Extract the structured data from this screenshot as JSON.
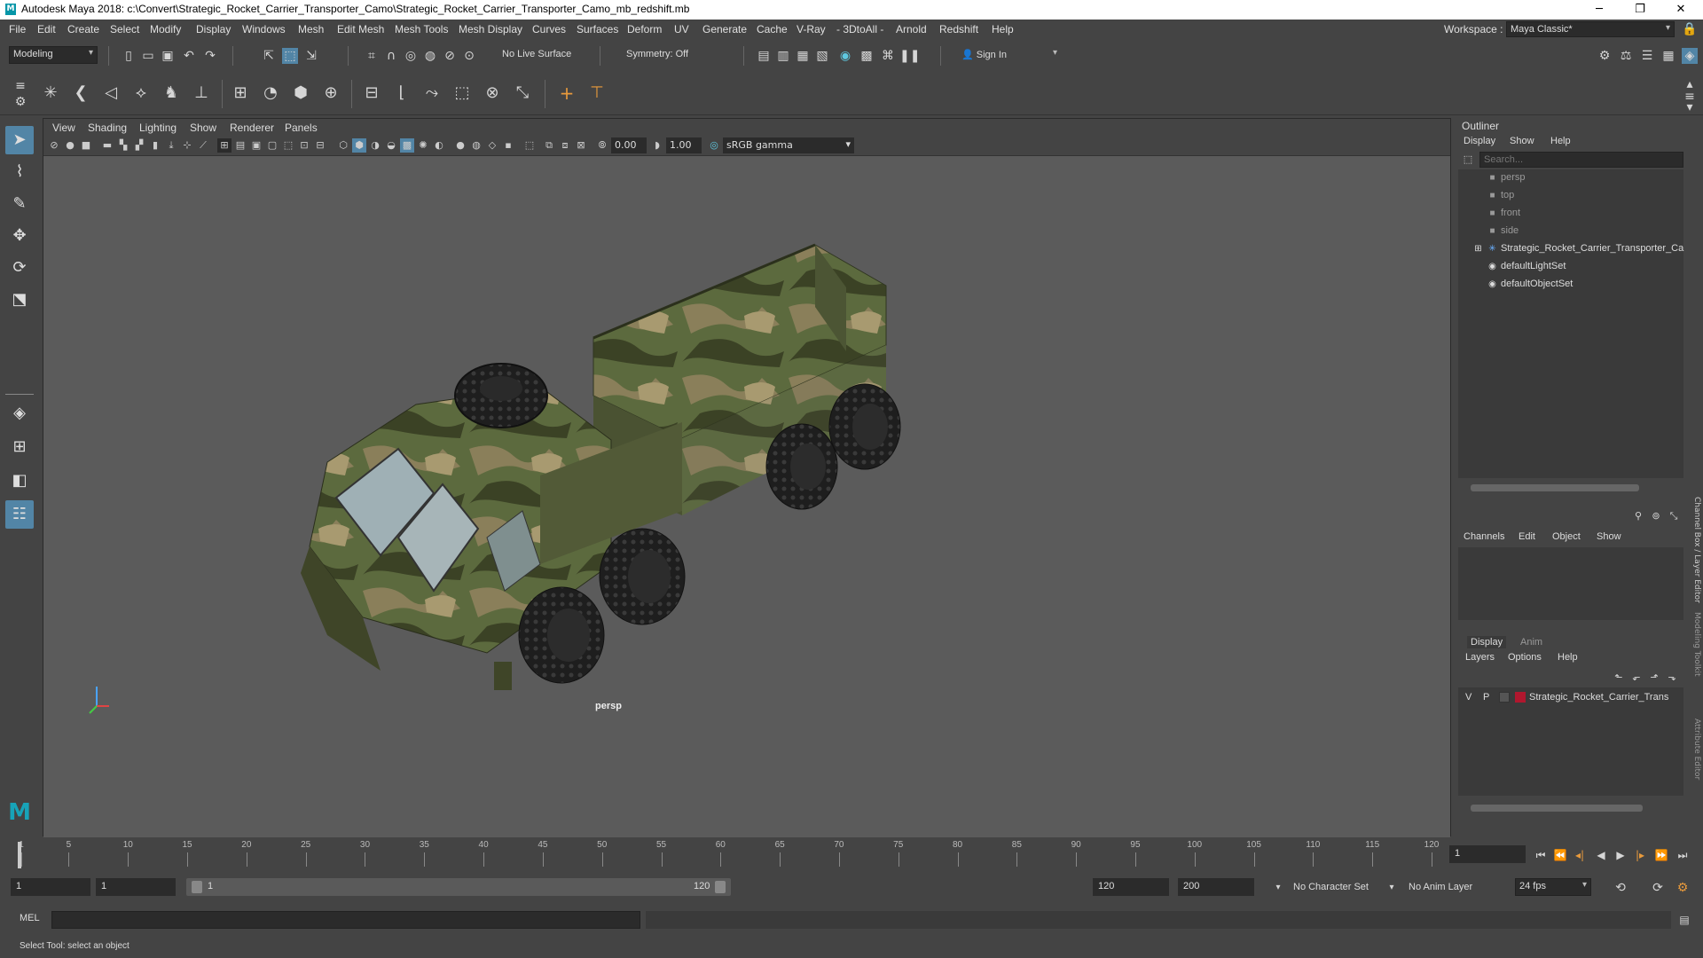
{
  "window": {
    "title": "Autodesk Maya 2018: c:\\Convert\\Strategic_Rocket_Carrier_Transporter_Camo\\Strategic_Rocket_Carrier_Transporter_Camo_mb_redshift.mb",
    "logo_letter": "M",
    "minimize": "─",
    "maximize": "❐",
    "close": "✕"
  },
  "menubar": [
    "File",
    "Edit",
    "Create",
    "Select",
    "Modify",
    "Display",
    "Windows",
    "Mesh",
    "Edit Mesh",
    "Mesh Tools",
    "Mesh Display",
    "Curves",
    "Surfaces",
    "Deform",
    "UV",
    "Generate",
    "Cache",
    "V-Ray",
    "- 3DtoAll -",
    "Arnold",
    "Redshift",
    "Help"
  ],
  "workspace": {
    "label": "Workspace :",
    "value": "Maya Classic*"
  },
  "statusline": {
    "mode": "Modeling",
    "live_surface": "No Live Surface",
    "symmetry": "Symmetry: Off",
    "sign_in": "Sign In"
  },
  "viewport": {
    "menus": [
      "View",
      "Shading",
      "Lighting",
      "Show",
      "Renderer",
      "Panels"
    ],
    "exposure": "0.00",
    "gamma": "1.00",
    "color_space": "sRGB gamma",
    "camera_label": "persp"
  },
  "outliner": {
    "title": "Outliner",
    "menus": [
      "Display",
      "Show",
      "Help"
    ],
    "search_placeholder": "Search...",
    "items": [
      {
        "label": "persp",
        "icon": "camera-icon",
        "dim": true
      },
      {
        "label": "top",
        "icon": "camera-icon",
        "dim": true
      },
      {
        "label": "front",
        "icon": "camera-icon",
        "dim": true
      },
      {
        "label": "side",
        "icon": "camera-icon",
        "dim": true
      },
      {
        "label": "Strategic_Rocket_Carrier_Transporter_Ca",
        "icon": "group-icon",
        "dim": false
      },
      {
        "label": "defaultLightSet",
        "icon": "set-icon",
        "dim": false
      },
      {
        "label": "defaultObjectSet",
        "icon": "set-icon",
        "dim": false
      }
    ]
  },
  "channelbox": {
    "menus": [
      "Channels",
      "Edit",
      "Object",
      "Show"
    ]
  },
  "layer_editor": {
    "tabs": [
      "Display",
      "Anim"
    ],
    "menus": [
      "Layers",
      "Options",
      "Help"
    ],
    "layer": {
      "v": "V",
      "p": "P",
      "name": "Strategic_Rocket_Carrier_Trans",
      "color": "#b0172e"
    }
  },
  "side_tabs": [
    "Channel Box / Layer Editor",
    "Modeling Toolkit",
    "Attribute Editor"
  ],
  "timeslider": {
    "ticks": [
      1,
      5,
      10,
      15,
      20,
      25,
      30,
      35,
      40,
      45,
      50,
      55,
      60,
      65,
      70,
      75,
      80,
      85,
      90,
      95,
      100,
      105,
      110,
      115,
      120
    ],
    "current_frame": "1"
  },
  "rangeslider": {
    "start": "1",
    "inner_start": "1",
    "bar_start": "1",
    "bar_end": "120",
    "end": "120",
    "outer_end": "200",
    "character_set": "No Character Set",
    "anim_layer": "No Anim Layer",
    "fps": "24 fps"
  },
  "cmdline": {
    "label": "MEL"
  },
  "helpline": {
    "text": "Select Tool: select an object"
  }
}
